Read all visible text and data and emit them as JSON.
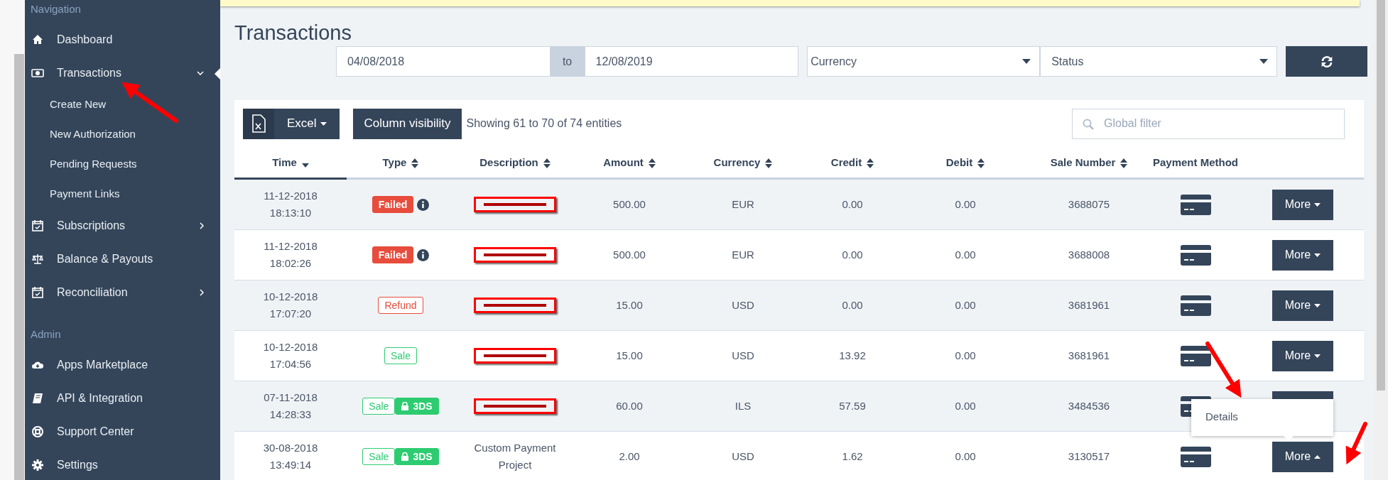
{
  "sidebar": {
    "sections": [
      {
        "title": "Navigation",
        "items": [
          {
            "label": "Dashboard",
            "selected": false
          },
          {
            "label": "Transactions",
            "selected": true,
            "expanded": true,
            "children": [
              {
                "label": "Create New"
              },
              {
                "label": "New Authorization"
              },
              {
                "label": "Pending Requests"
              },
              {
                "label": "Payment Links"
              }
            ]
          },
          {
            "label": "Subscriptions",
            "selected": false,
            "expanded": false
          },
          {
            "label": "Balance & Payouts",
            "selected": false
          },
          {
            "label": "Reconciliation",
            "selected": false,
            "expanded": false
          }
        ]
      },
      {
        "title": "Admin",
        "items": [
          {
            "label": "Apps Marketplace",
            "selected": false
          },
          {
            "label": "API & Integration",
            "selected": false
          },
          {
            "label": "Support Center",
            "selected": false
          },
          {
            "label": "Settings",
            "selected": false
          }
        ]
      }
    ]
  },
  "page": {
    "title": "Transactions"
  },
  "filters": {
    "date_from": "04/08/2018",
    "to_label": "to",
    "date_to": "12/08/2019",
    "currency": "Currency",
    "status": "Status"
  },
  "toolbar": {
    "export": "Excel",
    "column_visibility": "Column visibility",
    "info": "Showing 61 to 70 of 74 entities",
    "search_placeholder": "Global filter"
  },
  "table": {
    "columns": [
      {
        "label": "Time",
        "sortable": true,
        "sorted": true
      },
      {
        "label": "Type",
        "sortable": true,
        "sorted": false
      },
      {
        "label": "Description",
        "sortable": true,
        "sorted": false
      },
      {
        "label": "Amount",
        "sortable": true,
        "sorted": false
      },
      {
        "label": "Currency",
        "sortable": true,
        "sorted": false
      },
      {
        "label": "Credit",
        "sortable": true,
        "sorted": false
      },
      {
        "label": "Debit",
        "sortable": true,
        "sorted": false
      },
      {
        "label": "Sale Number",
        "sortable": true,
        "sorted": false
      },
      {
        "label": "Payment Method",
        "sortable": false,
        "sorted": false
      }
    ],
    "rows": [
      {
        "date": "11-12-2018",
        "time": "18:13:10",
        "badges": [
          {
            "kind": "failed",
            "label": "Failed"
          }
        ],
        "info": true,
        "description": {
          "redacted": true
        },
        "amount": "500.00",
        "currency": "EUR",
        "credit": "0.00",
        "debit": "0.00",
        "sale_number": "3688075",
        "action": "More",
        "menu_open": false
      },
      {
        "date": "11-12-2018",
        "time": "18:02:26",
        "badges": [
          {
            "kind": "failed",
            "label": "Failed"
          }
        ],
        "info": true,
        "description": {
          "redacted": true
        },
        "amount": "500.00",
        "currency": "EUR",
        "credit": "0.00",
        "debit": "0.00",
        "sale_number": "3688008",
        "action": "More",
        "menu_open": false
      },
      {
        "date": "10-12-2018",
        "time": "17:07:20",
        "badges": [
          {
            "kind": "refund",
            "label": "Refund"
          }
        ],
        "info": false,
        "description": {
          "redacted": true
        },
        "amount": "15.00",
        "currency": "USD",
        "credit": "0.00",
        "debit": "0.00",
        "sale_number": "3681961",
        "action": "More",
        "menu_open": false
      },
      {
        "date": "10-12-2018",
        "time": "17:04:56",
        "badges": [
          {
            "kind": "sale",
            "label": "Sale"
          }
        ],
        "info": false,
        "description": {
          "redacted": true
        },
        "amount": "15.00",
        "currency": "USD",
        "credit": "13.92",
        "debit": "0.00",
        "sale_number": "3681961",
        "action": "More",
        "menu_open": false
      },
      {
        "date": "07-11-2018",
        "time": "14:28:33",
        "badges": [
          {
            "kind": "sale",
            "label": "Sale"
          },
          {
            "kind": "secure",
            "label": "3DS"
          }
        ],
        "info": false,
        "description": {
          "redacted": true
        },
        "amount": "60.00",
        "currency": "ILS",
        "credit": "57.59",
        "debit": "0.00",
        "sale_number": "3484536",
        "menu_open": false
      },
      {
        "date": "30-08-2018",
        "time": "13:49:14",
        "badges": [
          {
            "kind": "sale",
            "label": "Sale"
          },
          {
            "kind": "secure",
            "label": "3DS"
          }
        ],
        "info": false,
        "description": {
          "redacted": false,
          "text": "Custom Payment Project"
        },
        "amount": "2.00",
        "currency": "USD",
        "credit": "1.62",
        "debit": "0.00",
        "sale_number": "3130517",
        "action": "More",
        "menu_open": true,
        "menu_items": [
          "Details"
        ]
      }
    ]
  }
}
